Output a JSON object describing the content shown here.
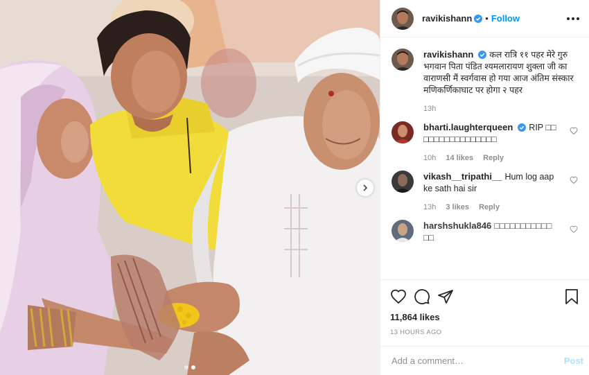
{
  "post": {
    "author": "ravikishann",
    "separator": "•",
    "follow_label": "Follow",
    "more_icon": "more-horizontal-icon",
    "colors": {
      "accent": "#0095f6",
      "text": "#262626",
      "muted": "#8e8e8e",
      "post_disabled": "#b2dffc"
    }
  },
  "caption": {
    "user": "ravikishann",
    "text": "कल रात्रि ११ पहर मेरे गुरु भगवान पिता पंडित श्यमलारायण शुक्ला जी का वाराणसी मैं स्वर्गवास हो गया आज अंतिम संस्कार मणिकर्णिकाघाट पर होगा २ पहर",
    "time": "13h"
  },
  "comments": [
    {
      "user": "bharti.laughterqueen",
      "verified": true,
      "text": "RIP □□ □□□□□□□□□□□□□□",
      "time": "10h",
      "likes": "14 likes",
      "reply": "Reply"
    },
    {
      "user": "vikash__tripathi__",
      "verified": false,
      "text": "Hum log aap ke sath hai sir",
      "time": "13h",
      "likes": "3 likes",
      "reply": "Reply"
    },
    {
      "user": "harshshukla846",
      "verified": false,
      "text": "□□□□□□□□□□□ □□",
      "time": "",
      "likes": "",
      "reply": ""
    }
  ],
  "engagement": {
    "likes": "11,864 likes",
    "time_ago": "13 HOURS AGO"
  },
  "add_comment": {
    "placeholder": "Add a comment…",
    "post_label": "Post"
  },
  "carousel": {
    "slides": 2,
    "active": 1
  }
}
